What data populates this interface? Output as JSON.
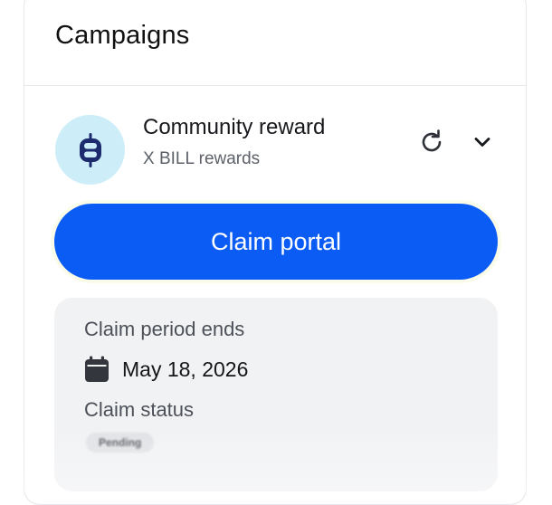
{
  "panel": {
    "title": "Campaigns"
  },
  "campaign": {
    "name": "Community reward",
    "subtitle": "X BILL rewards",
    "logo_icon": "bill-token-icon",
    "refresh_icon": "refresh-icon",
    "expand_icon": "chevron-down-icon"
  },
  "claim_button": {
    "label": "Claim portal",
    "color": "#0a5cf5"
  },
  "details": {
    "period_label": "Claim period ends",
    "period_icon": "calendar-icon",
    "period_value": "May 18, 2026",
    "status_label": "Claim status",
    "status_value": "Pending"
  },
  "colors": {
    "accent": "#0a5cf5",
    "logo_bg": "#cdeef9",
    "card_bg": "#f1f2f4"
  }
}
